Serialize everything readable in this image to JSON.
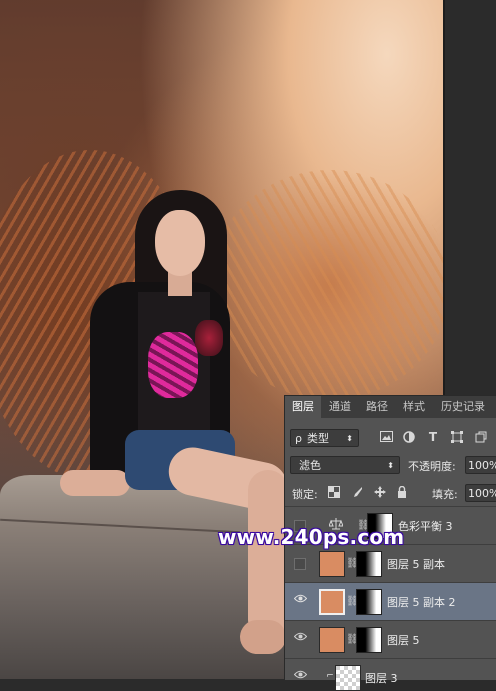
{
  "watermark": "www.240ps.com",
  "panel": {
    "tabs": [
      "图层",
      "通道",
      "路径",
      "样式",
      "历史记录"
    ],
    "active_tab": "图层",
    "filter": {
      "search_glyph": "ρ",
      "label": "类型"
    },
    "blend_mode": "滤色",
    "opacity": {
      "label": "不透明度:",
      "value": "100%"
    },
    "lock": {
      "label": "锁定:"
    },
    "fill": {
      "label": "填充:",
      "value": "100%"
    },
    "layers": [
      {
        "name": "色彩平衡 3",
        "type": "adjustment",
        "visible": false,
        "selected": false
      },
      {
        "name": "图层 5 副本",
        "type": "pixel",
        "visible": false,
        "selected": false
      },
      {
        "name": "图层 5 副本 2",
        "type": "pixel",
        "visible": true,
        "selected": true
      },
      {
        "name": "图层 5",
        "type": "pixel",
        "visible": true,
        "selected": false
      },
      {
        "name": "图层 3",
        "type": "pixel",
        "visible": true,
        "selected": false
      }
    ],
    "colors": {
      "layer_fill": "#d98c62",
      "selected_row": "#6a7586",
      "panel_bg": "#535353"
    }
  }
}
